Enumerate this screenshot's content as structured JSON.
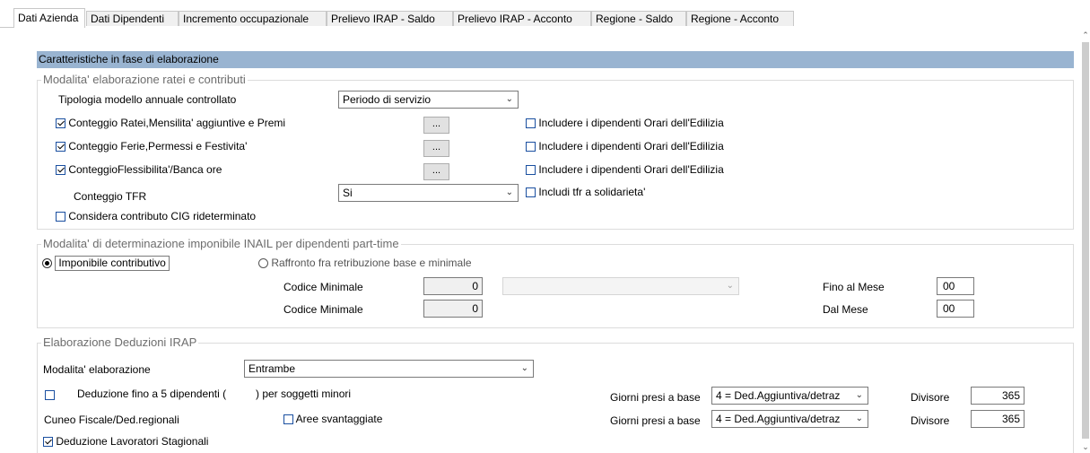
{
  "tabs": [
    {
      "label": "Dati Azienda",
      "active": true
    },
    {
      "label": "Dati Dipendenti"
    },
    {
      "label": "Incremento occupazionale"
    },
    {
      "label": "Prelievo IRAP - Saldo"
    },
    {
      "label": "Prelievo IRAP - Acconto"
    },
    {
      "label": "Regione - Saldo"
    },
    {
      "label": "Regione - Acconto"
    }
  ],
  "header": {
    "title": "Caratteristiche in fase di elaborazione"
  },
  "ratei": {
    "legend": "Modalita' elaborazione ratei e contributi",
    "tipologia_label": "Tipologia modello annuale controllato",
    "tipologia_value": "Periodo di servizio",
    "rows": [
      {
        "label": "Conteggio Ratei,Mensilita' aggiuntive e Premi",
        "checked": true,
        "button": "...",
        "include_label": "Includere i dipendenti Orari dell'Edilizia",
        "include_checked": false
      },
      {
        "label": "Conteggio Ferie,Permessi e Festivita'",
        "checked": true,
        "button": "...",
        "include_label": "Includere i dipendenti Orari dell'Edilizia",
        "include_checked": false
      },
      {
        "label": "ConteggioFlessibilita'/Banca ore",
        "checked": true,
        "button": "...",
        "include_label": "Includere i dipendenti Orari dell'Edilizia",
        "include_checked": false
      }
    ],
    "tfr_label": "Conteggio TFR",
    "tfr_value": "Si",
    "tfr_solidarieta_label": "Includi tfr a solidarieta'",
    "cig_label": "Considera contributo CIG rideterminato"
  },
  "inail": {
    "legend": "Modalita' di determinazione imponibile INAIL per dipendenti part-time",
    "radio1": "Imponibile contributivo",
    "radio2": "Raffronto fra retribuzione base e minimale",
    "codice1_label": "Codice Minimale",
    "codice1_value": "0",
    "codice2_label": "Codice Minimale",
    "codice2_value": "0",
    "fino_label": "Fino al Mese",
    "fino_value": "00",
    "dal_label": "Dal Mese",
    "dal_value": "00"
  },
  "irap": {
    "legend": "Elaborazione Deduzioni IRAP",
    "modalita_label": "Modalita' elaborazione",
    "modalita_value": "Entrambe",
    "deduzione_label_a": "Deduzione fino a 5 dipendenti (",
    "deduzione_label_b": ") per soggetti minori",
    "cuneo_label": "Cuneo Fiscale/Ded.regionali",
    "aree_label": "Aree svantaggiate",
    "stagionali_label": "Deduzione Lavoratori  Stagionali",
    "giorni1_label": "Giorni presi a base",
    "giorni1_value": "4 = Ded.Aggiuntiva/detraz",
    "divisore1_label": "Divisore",
    "divisore1_value": "365",
    "giorni2_label": "Giorni presi a base",
    "giorni2_value": "4 = Ded.Aggiuntiva/detraz",
    "divisore2_label": "Divisore",
    "divisore2_value": "365"
  },
  "icons": {
    "scroll_up": "chevron-up-icon",
    "scroll_down": "chevron-down-icon",
    "dropdown": "chevron-down-icon"
  },
  "colors": {
    "header_bar": "#99b4d1",
    "checkbox_border": "#1a4fa0"
  }
}
